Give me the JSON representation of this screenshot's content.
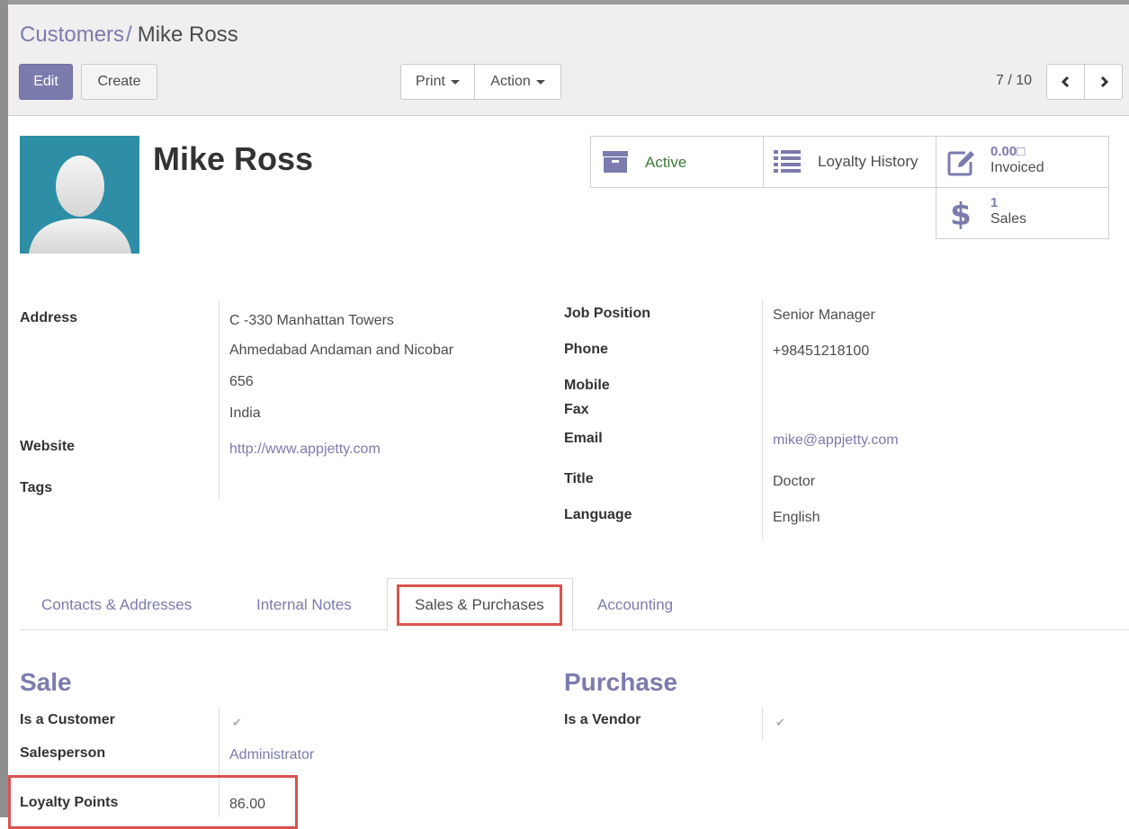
{
  "breadcrumb": {
    "parent": "Customers",
    "separator": "/",
    "current": "Mike Ross"
  },
  "toolbar": {
    "edit": "Edit",
    "create": "Create",
    "print": "Print",
    "action": "Action"
  },
  "pager": {
    "value": "7 / 10"
  },
  "partner": {
    "name": "Mike Ross"
  },
  "smart_buttons": {
    "active": "Active",
    "loyalty": "Loyalty History",
    "invoiced_amount": "0.00□",
    "invoiced_label": "Invoiced",
    "sales_count": "1",
    "sales_label": "Sales"
  },
  "left_fields": {
    "address_label": "Address",
    "address_line1": "C -330 Manhattan Towers",
    "address_line2": "Ahmedabad Andaman and Nicobar",
    "address_line3": "656",
    "address_line4": "India",
    "website_label": "Website",
    "website_value": "http://www.appjetty.com",
    "tags_label": "Tags"
  },
  "right_fields": {
    "job_label": "Job Position",
    "job_value": "Senior Manager",
    "phone_label": "Phone",
    "phone_value": "+98451218100",
    "mobile_label": "Mobile",
    "fax_label": "Fax",
    "email_label": "Email",
    "email_value": "mike@appjetty.com",
    "title_label": "Title",
    "title_value": "Doctor",
    "language_label": "Language",
    "language_value": "English"
  },
  "tabs": {
    "contacts": "Contacts & Addresses",
    "notes": "Internal Notes",
    "sales": "Sales & Purchases",
    "accounting": "Accounting"
  },
  "sale": {
    "title": "Sale",
    "customer_label": "Is a Customer",
    "salesperson_label": "Salesperson",
    "salesperson_value": "Administrator",
    "loyalty_label": "Loyalty Points",
    "loyalty_value": "86.00"
  },
  "purchase": {
    "title": "Purchase",
    "vendor_label": "Is a Vendor"
  },
  "colors": {
    "brand": "#7c7bad",
    "highlight": "#d9534f",
    "active_text": "#3d7a3d"
  }
}
